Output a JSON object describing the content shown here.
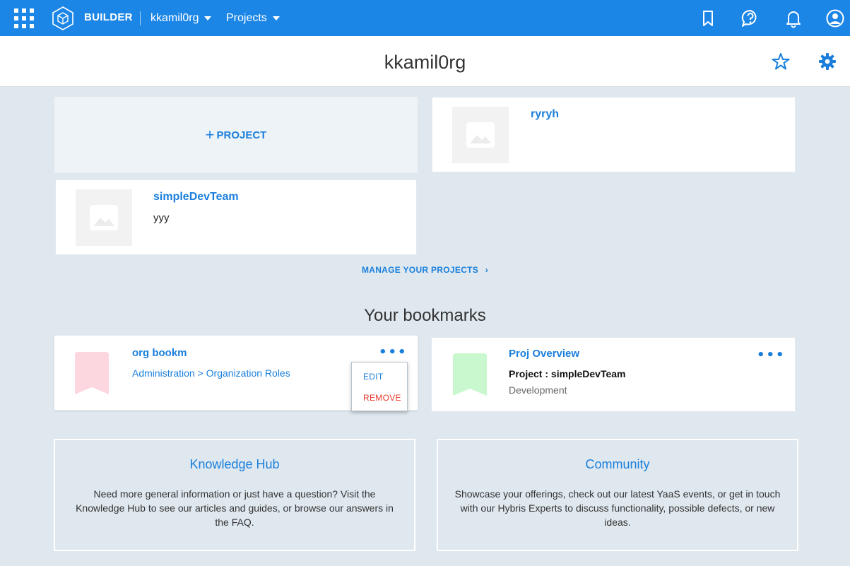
{
  "topbar": {
    "brand": "BUILDER",
    "org_dropdown": "kkamil0rg",
    "projects_dropdown": "Projects",
    "color": "#1c86e6"
  },
  "header": {
    "title": "kkamil0rg"
  },
  "projects": {
    "add_label": "PROJECT",
    "items": [
      {
        "name": "ryryh",
        "description": ""
      },
      {
        "name": "simpleDevTeam",
        "description": "yyy"
      }
    ],
    "manage_link": "MANAGE YOUR PROJECTS"
  },
  "bookmarks": {
    "title": "Your bookmarks",
    "items": [
      {
        "name": "org bookm",
        "path": "Administration > Organization Roles",
        "ribbon_color": "#fdd7e0"
      },
      {
        "name": "Proj Overview",
        "project": "Project : simpleDevTeam",
        "section": "Development",
        "ribbon_color": "#c9f8cf"
      }
    ],
    "menu": {
      "edit": "EDIT",
      "remove": "REMOVE"
    }
  },
  "info": {
    "knowledge": {
      "title": "Knowledge Hub",
      "text": "Need more general information or just have a question? Visit the Knowledge Hub to see our articles and guides, or browse our answers in the FAQ."
    },
    "community": {
      "title": "Community",
      "text": "Showcase your offerings, check out our latest YaaS events, or get in touch with our Hybris Experts to discuss functionality, possible defects, or new ideas."
    }
  }
}
